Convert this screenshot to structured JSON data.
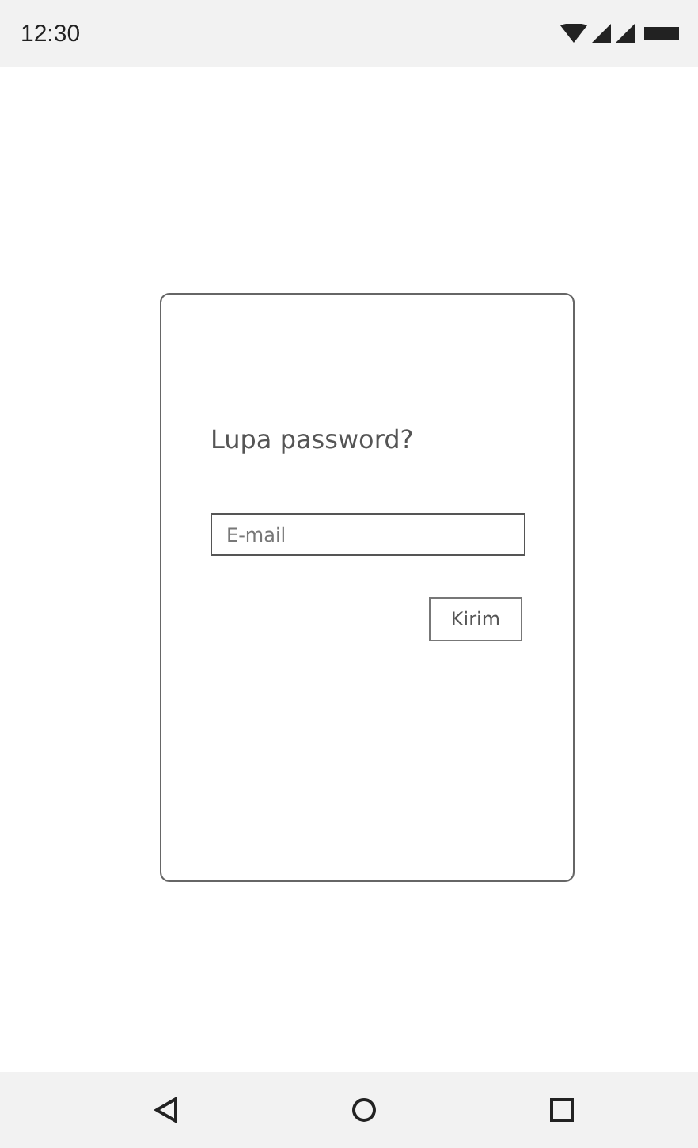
{
  "status_bar": {
    "time": "12:30"
  },
  "dialog": {
    "title": "Lupa password?",
    "email": {
      "placeholder": "E-mail"
    },
    "submit": "Kirim"
  }
}
